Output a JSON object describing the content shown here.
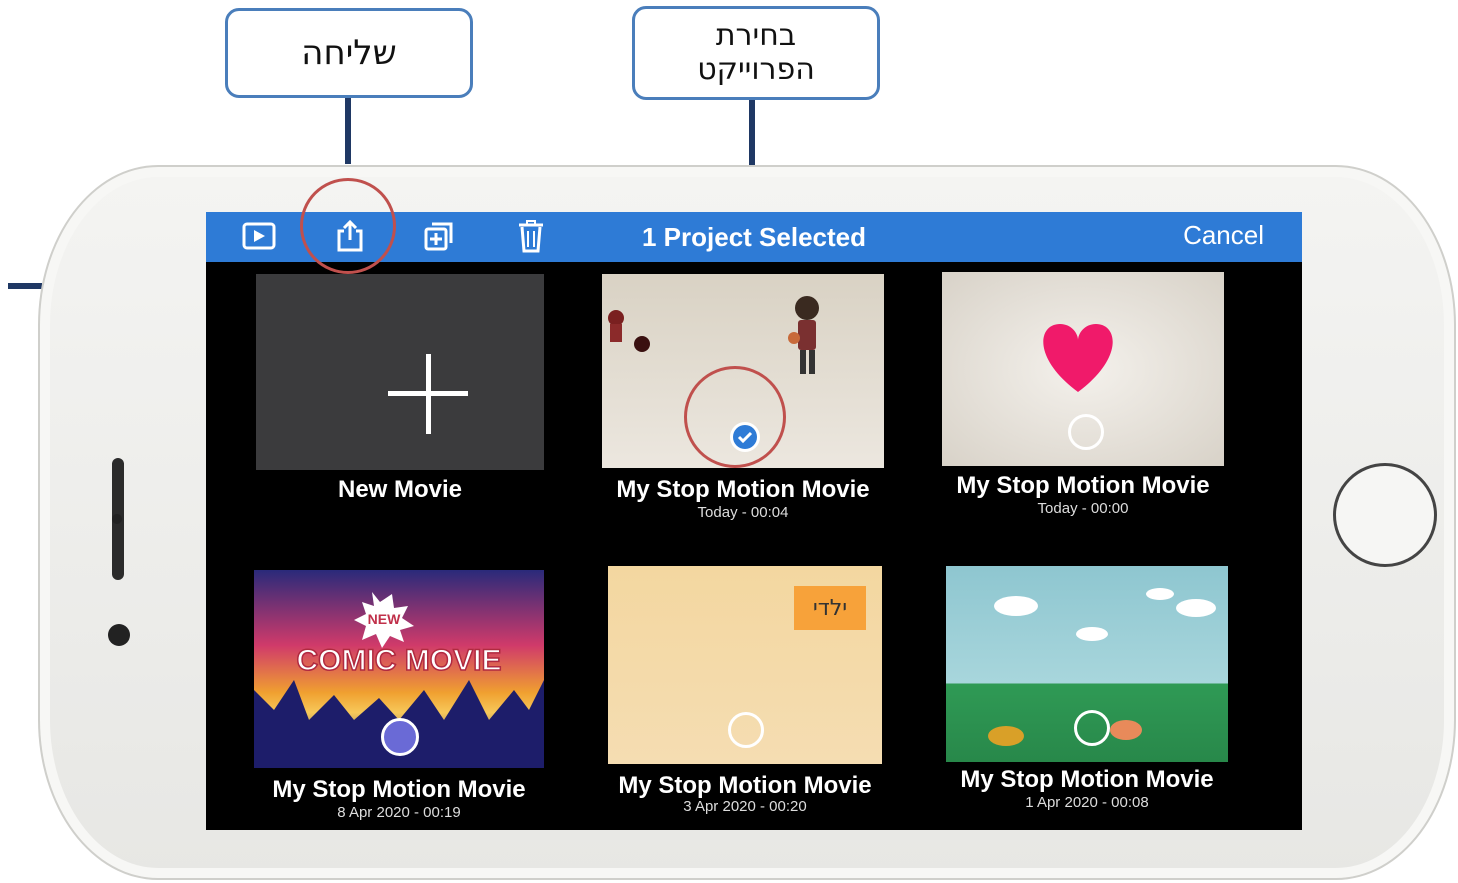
{
  "callouts": {
    "send_label": "שליחה",
    "select_line1": "בחירת",
    "select_line2": "הפרוייקט"
  },
  "toolbar": {
    "title": "1 Project Selected",
    "cancel_label": "Cancel",
    "icons": [
      "play-icon",
      "share-icon",
      "duplicate-icon",
      "trash-icon"
    ]
  },
  "projects": [
    {
      "title": "New Movie",
      "date": ""
    },
    {
      "title": "My Stop Motion Movie",
      "date": "Today - 00:04",
      "selected": true
    },
    {
      "title": "My Stop Motion Movie",
      "date": "Today - 00:00"
    },
    {
      "title": "My Stop Motion Movie",
      "date": "8 Apr 2020 - 00:19"
    },
    {
      "title": "My Stop Motion Movie",
      "date": "3 Apr 2020 - 00:20"
    },
    {
      "title": "My Stop Motion Movie",
      "date": "1 Apr 2020 - 00:08"
    }
  ],
  "thumb_text": {
    "comic_new": "NEW",
    "comic_title": "COMIC MOVIE",
    "note": "ילדי"
  },
  "colors": {
    "toolbar": "#2e7bd6",
    "highlight_ring": "#c0504d",
    "callout_border": "#4a7ebb",
    "check": "#2e7bd6"
  }
}
